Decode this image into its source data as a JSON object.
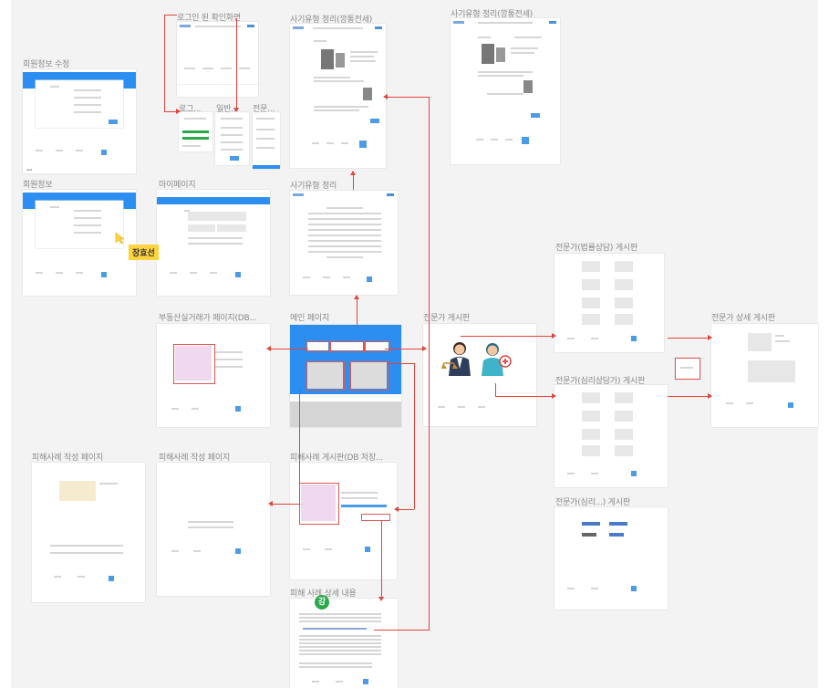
{
  "labels": {
    "login_check": "로그인 된 확인화면",
    "scam_type_1": "사기유형 정리(깡통전세)",
    "scam_type_2": "사기유형 정리(깡통전세)",
    "member_edit": "회원정보 수정",
    "login": "로그...",
    "general": "일반...",
    "expert": "전문...",
    "member_info": "회원정보",
    "mypage": "마이페이지",
    "scam_type": "사기유형 정리",
    "expert_legal": "전문가(법률상담) 게시판",
    "realestate": "부동산실거래가 페이지(DB...",
    "main_page": "메인 페이지",
    "expert_board": "전문가 게시판",
    "expert_detail": "전문가 상세 게시판",
    "expert_psych": "전문가(심리상담가) 게시판",
    "damage_write_1": "피해사례 작성 페이지",
    "damage_write_2": "피해사례 작성 페이지",
    "damage_board": "피해사례 게시판(DB 저장...",
    "expert_psych2": "전문가(심리...) 게시판",
    "damage_detail": "피해 사례 상세 내용"
  },
  "sticky_note": "장효선",
  "avatar_initial": "강",
  "colors": {
    "accent_blue": "#2c8ef0",
    "connector_red": "#e1453c",
    "sticky_yellow": "#ffd23f",
    "avatar_green": "#2aa84a"
  }
}
